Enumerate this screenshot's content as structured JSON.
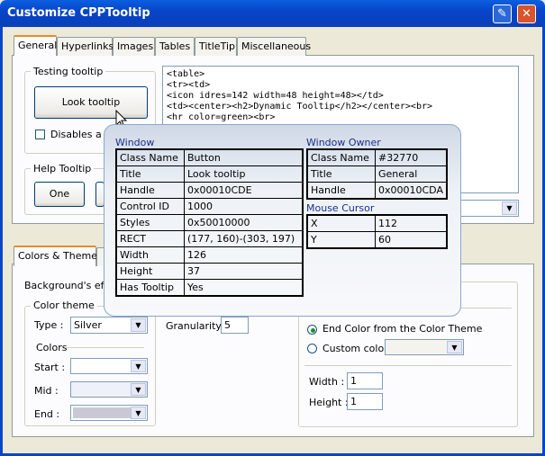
{
  "window": {
    "title": "Customize CPPTooltip",
    "pin_icon": "pin-icon",
    "close_icon": "close-icon"
  },
  "top_tabs": [
    "General",
    "Hyperlinks",
    "Images",
    "Tables",
    "TitleTip",
    "Miscellaneous"
  ],
  "testing": {
    "group_label": "Testing tooltip",
    "look_button": "Look tooltip",
    "disables_label": "Disables a b"
  },
  "help": {
    "group_label": "Help Tooltip",
    "one_button": "One"
  },
  "code_lines": [
    "<table>",
    "<tr><td>",
    "<icon idres=142 width=48 height=48></td>",
    "<td><center><h2>Dynamic Tooltip</h2></center><br>",
    "<hr color=green><br>"
  ],
  "bottom_tabs": [
    "Colors & Themes"
  ],
  "colors": {
    "background_effect_label": "Background's effe",
    "color_theme_label": "Color theme",
    "type_label": "Type :",
    "type_value": "Silver",
    "colors_label": "Colors",
    "start_label": "Start :",
    "mid_label": "Mid :",
    "end_label": "End :",
    "start_color": "#ffffff",
    "mid_color": "#eef0fa",
    "end_color": "#c9c9d6"
  },
  "granularity": {
    "label": "Granularity :",
    "value": "5"
  },
  "end_color_opts": {
    "opt1": "End Color from the Color Theme",
    "opt2": "Custom color",
    "width_label": "Width :",
    "width_value": "1",
    "height_label": "Height :",
    "height_value": "1"
  },
  "tooltip": {
    "window_title": "Window",
    "window_rows": [
      [
        "Class Name",
        "Button"
      ],
      [
        "Title",
        "Look tooltip"
      ],
      [
        "Handle",
        "0x00010CDE"
      ],
      [
        "Control ID",
        "1000"
      ],
      [
        "Styles",
        "0x50010000"
      ],
      [
        "RECT",
        "(177, 160)-(303, 197)"
      ],
      [
        "Width",
        "126"
      ],
      [
        "Height",
        "37"
      ],
      [
        "Has Tooltip",
        "Yes"
      ]
    ],
    "owner_title": "Window Owner",
    "owner_rows": [
      [
        "Class Name",
        "#32770"
      ],
      [
        "Title",
        "General"
      ],
      [
        "Handle",
        "0x00010CDA"
      ]
    ],
    "cursor_title": "Mouse Cursor",
    "cursor_rows": [
      [
        "X",
        "112"
      ],
      [
        "Y",
        "60"
      ]
    ]
  }
}
